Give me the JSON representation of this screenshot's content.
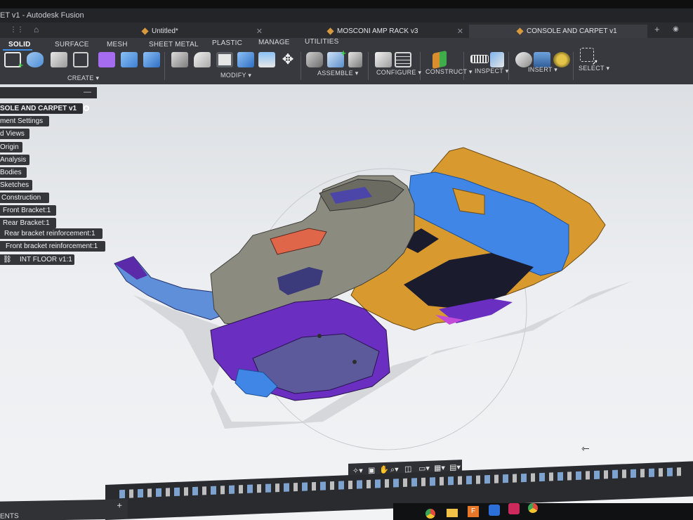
{
  "window": {
    "title": "ET v1 - Autodesk Fusion"
  },
  "tabs": [
    {
      "label": "Untitled*",
      "active": false
    },
    {
      "label": "MOSCONI AMP RACK v3",
      "active": false
    },
    {
      "label": "CONSOLE AND CARPET v1",
      "active": true
    }
  ],
  "ribbon": {
    "workspace_tabs": [
      "SOLID",
      "SURFACE",
      "MESH",
      "SHEET METAL",
      "PLASTIC",
      "MANAGE",
      "UTILITIES"
    ],
    "active_tab": "SOLID",
    "groups": [
      "CREATE ▾",
      "MODIFY ▾",
      "ASSEMBLE ▾",
      "CONFIGURE ▾",
      "CONSTRUCT ▾",
      "INSPECT ▾",
      "INSERT ▾",
      "SELECT ▾"
    ]
  },
  "browser": {
    "nodes": [
      "SOLE AND CARPET v1",
      "ment Settings",
      "d Views",
      "Origin",
      "Analysis",
      "Bodies",
      "Sketches",
      "Construction",
      "Front Bracket:1",
      "Rear Bracket:1",
      "Rear bracket reinforcement:1",
      "Front bracket reinforcement:1",
      "INT FLOOR v1:1"
    ]
  },
  "comments": {
    "label": "ENTS"
  },
  "colors": {
    "orange_body": "#d99a2e",
    "blue_body": "#3f86e6",
    "purple_body": "#6a2fc0",
    "grey_body": "#8f8f84",
    "red_face": "#e0664a"
  }
}
